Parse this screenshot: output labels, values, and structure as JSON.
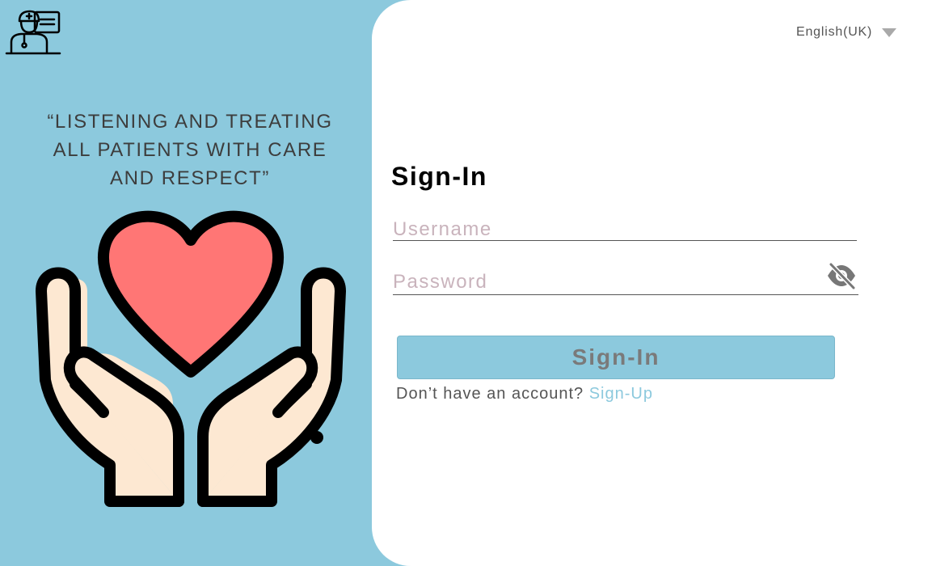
{
  "left": {
    "quote": "“LISTENING AND TREATING\nALL PATIENTS WITH CARE\nAND RESPECT”"
  },
  "header": {
    "language": "English(UK)"
  },
  "form": {
    "title": "Sign-In",
    "username_placeholder": "Username",
    "username_value": "",
    "password_placeholder": "Password",
    "password_value": "",
    "submit_label": "Sign-In",
    "no_account_text": "Don’t have an account?",
    "signup_label": "Sign-Up"
  },
  "colors": {
    "panel_blue": "#8cc9dd",
    "heart": "#ff7675",
    "hand": "#fde8d2",
    "outline": "#000000"
  },
  "icons": [
    "doctor-logo-icon",
    "dropdown-caret-icon",
    "eye-slash-icon",
    "heart-hands-illustration"
  ]
}
